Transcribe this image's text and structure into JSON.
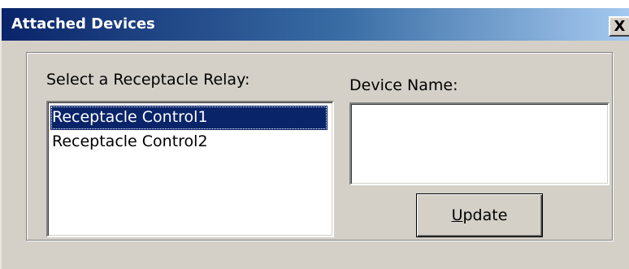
{
  "window": {
    "title": "Attached Devices",
    "close_label": "X"
  },
  "relay_section": {
    "label": "Select a Receptacle Relay:",
    "items": [
      {
        "label": "Receptacle Control1",
        "selected": true
      },
      {
        "label": "Receptacle Control2",
        "selected": false
      }
    ]
  },
  "device_section": {
    "label": "Device Name:",
    "value": "",
    "placeholder": ""
  },
  "update_button": {
    "mnemonic": "U",
    "rest": "pdate"
  },
  "colors": {
    "title_bar_start": "#0a246a",
    "title_bar_end": "#a6caf0",
    "face": "#d4d0c8",
    "selection": "#0a246a"
  }
}
